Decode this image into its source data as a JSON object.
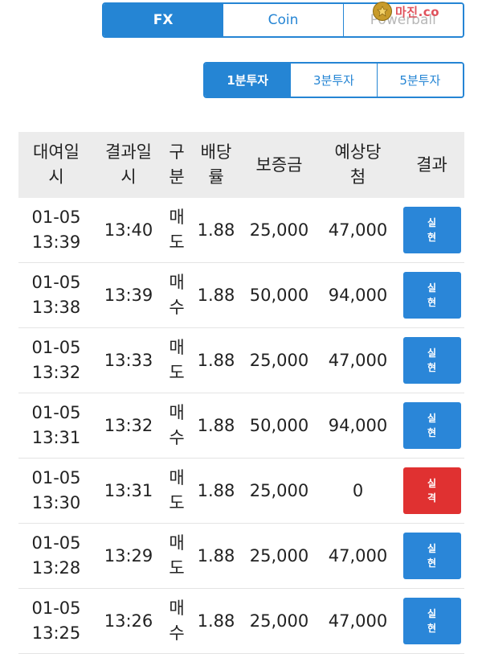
{
  "market_tabs": [
    {
      "label": "FX",
      "active": true
    },
    {
      "label": "Coin",
      "active": false
    },
    {
      "label": "Powerball",
      "active": false
    }
  ],
  "watermark": {
    "text": "마진.co"
  },
  "interval_tabs": [
    {
      "label": "1분투자",
      "active": true
    },
    {
      "label": "3분투자",
      "active": false
    },
    {
      "label": "5분투자",
      "active": false
    }
  ],
  "table": {
    "headers": [
      "대여일시",
      "결과일시",
      "구분",
      "배당률",
      "보증금",
      "예상당첨",
      "결과"
    ],
    "rows": [
      {
        "rental_date": "01-05",
        "rental_time": "13:39",
        "result_time": "13:40",
        "side": "매도",
        "side_type": "sell",
        "odds": "1.88",
        "deposit": "25,000",
        "expected": "47,000",
        "result": "실현",
        "result_type": "win"
      },
      {
        "rental_date": "01-05",
        "rental_time": "13:38",
        "result_time": "13:39",
        "side": "매수",
        "side_type": "buy",
        "odds": "1.88",
        "deposit": "50,000",
        "expected": "94,000",
        "result": "실현",
        "result_type": "win"
      },
      {
        "rental_date": "01-05",
        "rental_time": "13:32",
        "result_time": "13:33",
        "side": "매도",
        "side_type": "sell",
        "odds": "1.88",
        "deposit": "25,000",
        "expected": "47,000",
        "result": "실현",
        "result_type": "win"
      },
      {
        "rental_date": "01-05",
        "rental_time": "13:31",
        "result_time": "13:32",
        "side": "매수",
        "side_type": "buy",
        "odds": "1.88",
        "deposit": "50,000",
        "expected": "94,000",
        "result": "실현",
        "result_type": "win"
      },
      {
        "rental_date": "01-05",
        "rental_time": "13:30",
        "result_time": "13:31",
        "side": "매도",
        "side_type": "sell",
        "odds": "1.88",
        "deposit": "25,000",
        "expected": "0",
        "result": "실격",
        "result_type": "lose"
      },
      {
        "rental_date": "01-05",
        "rental_time": "13:28",
        "result_time": "13:29",
        "side": "매도",
        "side_type": "sell",
        "odds": "1.88",
        "deposit": "25,000",
        "expected": "47,000",
        "result": "실현",
        "result_type": "win"
      },
      {
        "rental_date": "01-05",
        "rental_time": "13:25",
        "result_time": "13:26",
        "side": "매수",
        "side_type": "buy",
        "odds": "1.88",
        "deposit": "25,000",
        "expected": "47,000",
        "result": "실현",
        "result_type": "win"
      }
    ]
  },
  "colors": {
    "accent": "#2585d4",
    "sell": "#1a1ad0",
    "buy": "#e01818",
    "win": "#2a86d8",
    "lose": "#e03131",
    "header_bg": "#ececec"
  }
}
